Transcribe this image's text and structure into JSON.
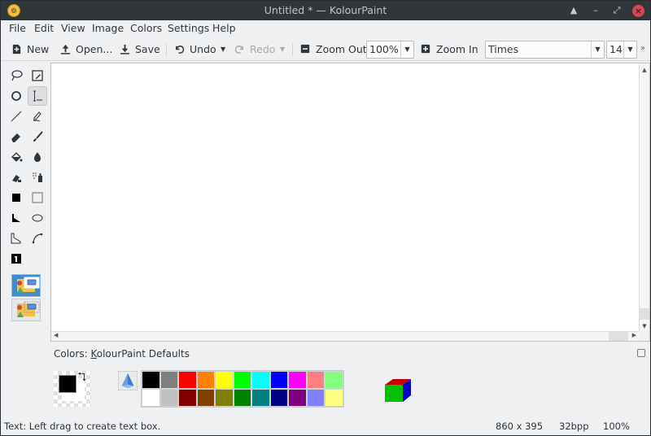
{
  "window": {
    "title": "Untitled * — KolourPaint"
  },
  "menu": [
    "File",
    "Edit",
    "View",
    "Image",
    "Colors",
    "Settings",
    "Help"
  ],
  "toolbar": {
    "new_label": "New",
    "open_label": "Open...",
    "save_label": "Save",
    "undo_label": "Undo",
    "redo_label": "Redo",
    "zoom_out_label": "Zoom Out",
    "zoom_value": "100%",
    "zoom_in_label": "Zoom In",
    "font_family": "Times",
    "font_size": "14",
    "overflow_label": "»"
  },
  "tools": [
    {
      "name": "free-form-selection",
      "active": false
    },
    {
      "name": "rectangular-selection",
      "active": false
    },
    {
      "name": "ellipse",
      "active": false
    },
    {
      "name": "text",
      "active": true
    },
    {
      "name": "line",
      "active": false
    },
    {
      "name": "pen",
      "active": false
    },
    {
      "name": "eraser",
      "active": false
    },
    {
      "name": "brush",
      "active": false
    },
    {
      "name": "flood-fill",
      "active": false
    },
    {
      "name": "color-picker",
      "active": false
    },
    {
      "name": "color-eraser",
      "active": false
    },
    {
      "name": "spraycan",
      "active": false
    },
    {
      "name": "rectangle",
      "active": false
    },
    {
      "name": "rectangle-outline",
      "active": false
    },
    {
      "name": "polygon",
      "active": false
    },
    {
      "name": "ellipse-outline",
      "active": false
    },
    {
      "name": "polyline",
      "active": false
    },
    {
      "name": "curve",
      "active": false
    },
    {
      "name": "rounded-rectangle",
      "active": false
    }
  ],
  "selection_modes": [
    {
      "name": "opaque-selection",
      "active": true
    },
    {
      "name": "transparent-selection",
      "active": false
    }
  ],
  "colors": {
    "label_prefix": "Colors: ",
    "label_underlined": "K",
    "label_rest": "olourPaint Defaults",
    "foreground": "#000000",
    "background": "#ffffff",
    "palette_row1": [
      "#000000",
      "#808080",
      "#ff0000",
      "#ff8000",
      "#ffff00",
      "#00ff00",
      "#00ffff",
      "#0000ff",
      "#ff00ff",
      "#ff8080",
      "#80ff80"
    ],
    "palette_row2": [
      "#ffffff",
      "#c0c0c0",
      "#800000",
      "#804000",
      "#808000",
      "#008000",
      "#008080",
      "#000080",
      "#800080",
      "#8080ff",
      "#ffff80"
    ]
  },
  "status": {
    "message": "Text: Left drag to create text box.",
    "dimensions": "860 x 395",
    "bpp": "32bpp",
    "zoom": "100%"
  }
}
